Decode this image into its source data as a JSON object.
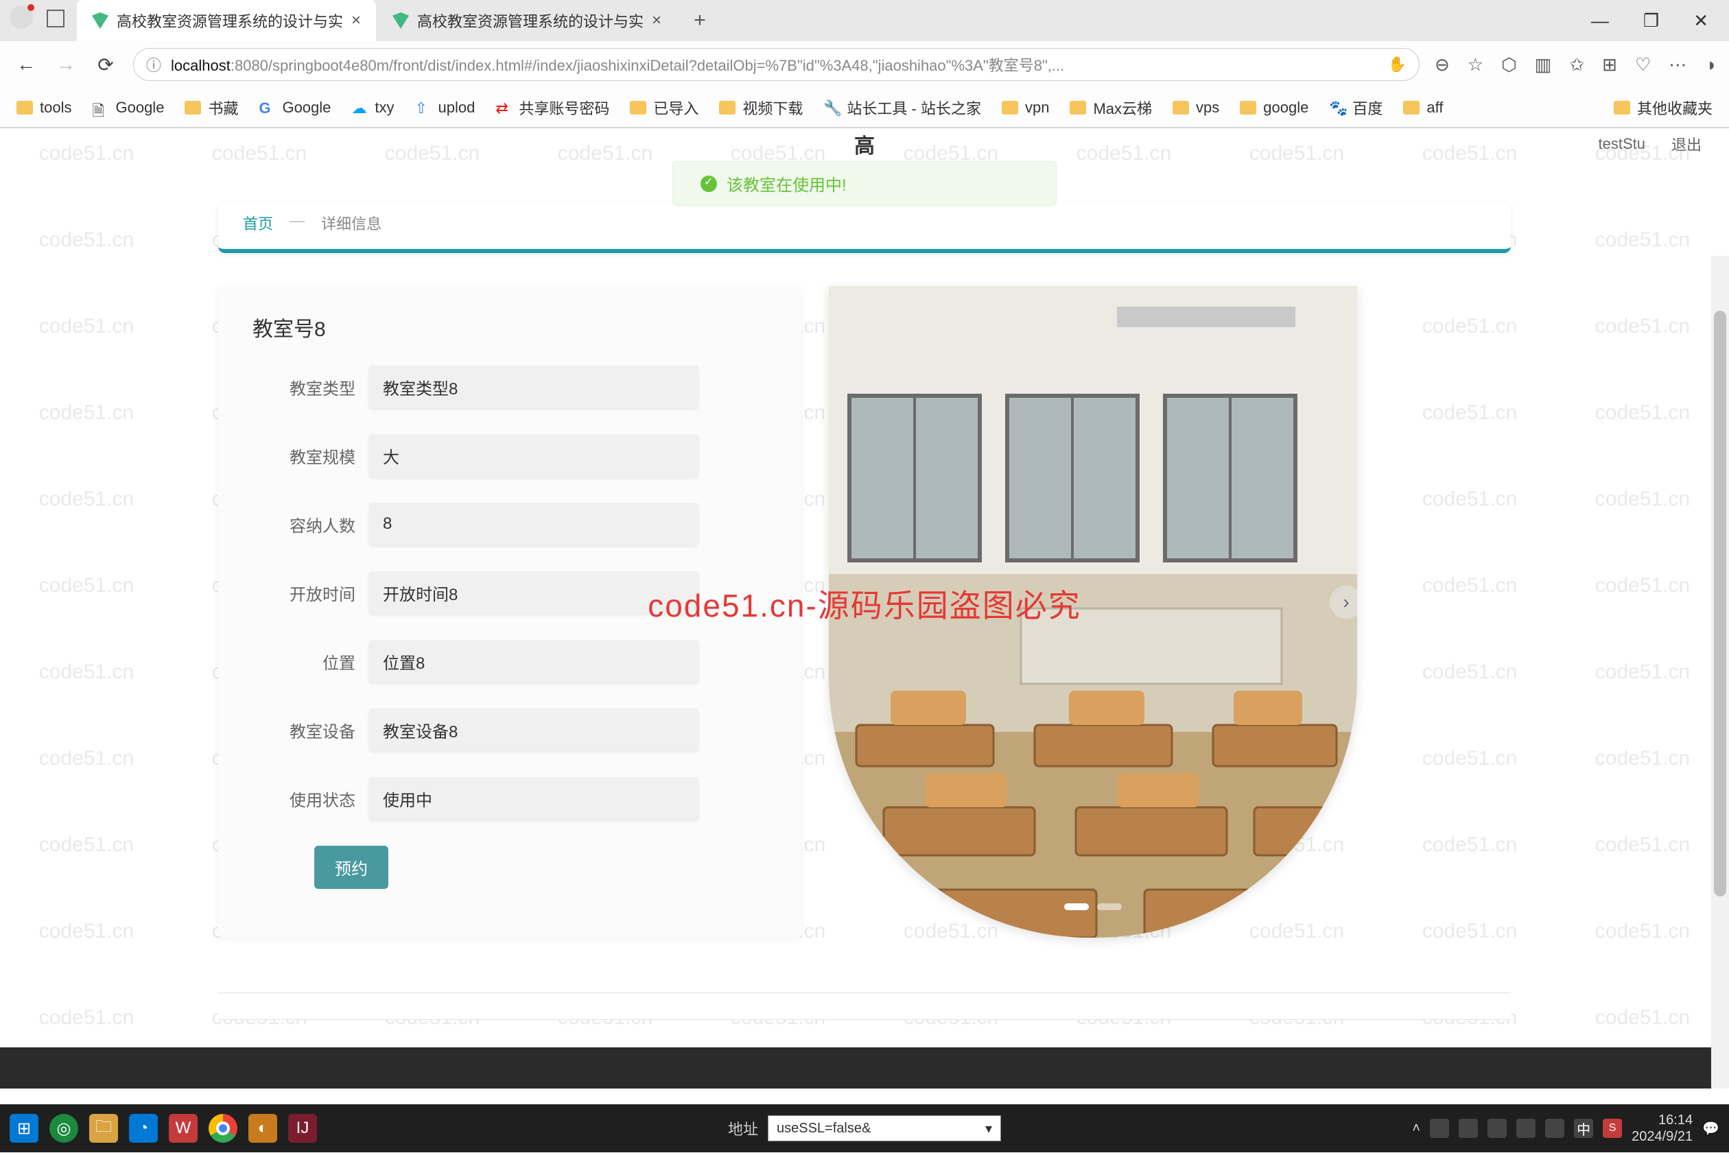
{
  "browser": {
    "tab1_title": "高校教室资源管理系统的设计与实",
    "tab2_title": "高校教室资源管理系统的设计与实",
    "url_host": "localhost",
    "url_port": ":8080",
    "url_path": "/springboot4e80m/front/dist/index.html#/index/jiaoshixinxiDetail?detailObj=%7B\"id\"%3A48,\"jiaoshihao\"%3A\"教室号8\",..."
  },
  "bookmarks": {
    "items": [
      "tools",
      "Google",
      "书藏",
      "Google",
      "txy",
      "uplod",
      "共享账号密码",
      "已导入",
      "视频下载",
      "站长工具 - 站长之家",
      "vpn",
      "Max云梯",
      "vps",
      "google",
      "百度",
      "aff"
    ],
    "overflow": "其他收藏夹"
  },
  "watermark_text": "code51.cn",
  "watermark_overlay": "code51.cn-源码乐园盗图必究",
  "app": {
    "header_title": "高",
    "user_label": "testStu",
    "logout": "退出"
  },
  "toast": {
    "message": "该教室在使用中!"
  },
  "breadcrumb": {
    "home": "首页",
    "current": "详细信息"
  },
  "form": {
    "title": "教室号8",
    "rows": [
      {
        "label": "教室类型",
        "value": "教室类型8"
      },
      {
        "label": "教室规模",
        "value": "大"
      },
      {
        "label": "容纳人数",
        "value": "8"
      },
      {
        "label": "开放时间",
        "value": "开放时间8"
      },
      {
        "label": "位置",
        "value": "位置8"
      },
      {
        "label": "教室设备",
        "value": "教室设备8"
      },
      {
        "label": "使用状态",
        "value": "使用中"
      }
    ],
    "reserve_btn": "预约"
  },
  "taskbar": {
    "addr_label": "地址",
    "addr_value": "useSSL=false&",
    "ime": "中",
    "time": "16:14",
    "date": "2024/9/21"
  },
  "colors": {
    "accent": "#1a9ca7",
    "reserve_btn": "#4a99a1",
    "toast_bg": "#f0f9eb",
    "toast_fg": "#67c23a"
  }
}
